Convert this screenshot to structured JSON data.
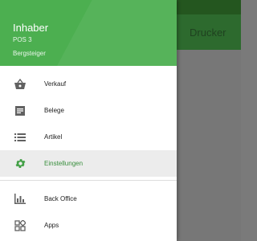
{
  "app": {
    "title": "Drucker"
  },
  "drawer": {
    "owner": "Inhaber",
    "pos": "POS 3",
    "store": "Bergsteiger"
  },
  "menu": {
    "items": [
      {
        "label": "Verkauf",
        "icon": "basket-icon"
      },
      {
        "label": "Belege",
        "icon": "receipt-icon"
      },
      {
        "label": "Artikel",
        "icon": "list-icon"
      },
      {
        "label": "Einstellungen",
        "icon": "gear-icon",
        "active": true
      }
    ],
    "secondary": [
      {
        "label": "Back Office",
        "icon": "bar-chart-icon"
      },
      {
        "label": "Apps",
        "icon": "apps-icon"
      }
    ]
  },
  "colors": {
    "header": "#4caf50",
    "active_text": "#388e3c",
    "icon": "#616161",
    "active_icon": "#43a047"
  }
}
